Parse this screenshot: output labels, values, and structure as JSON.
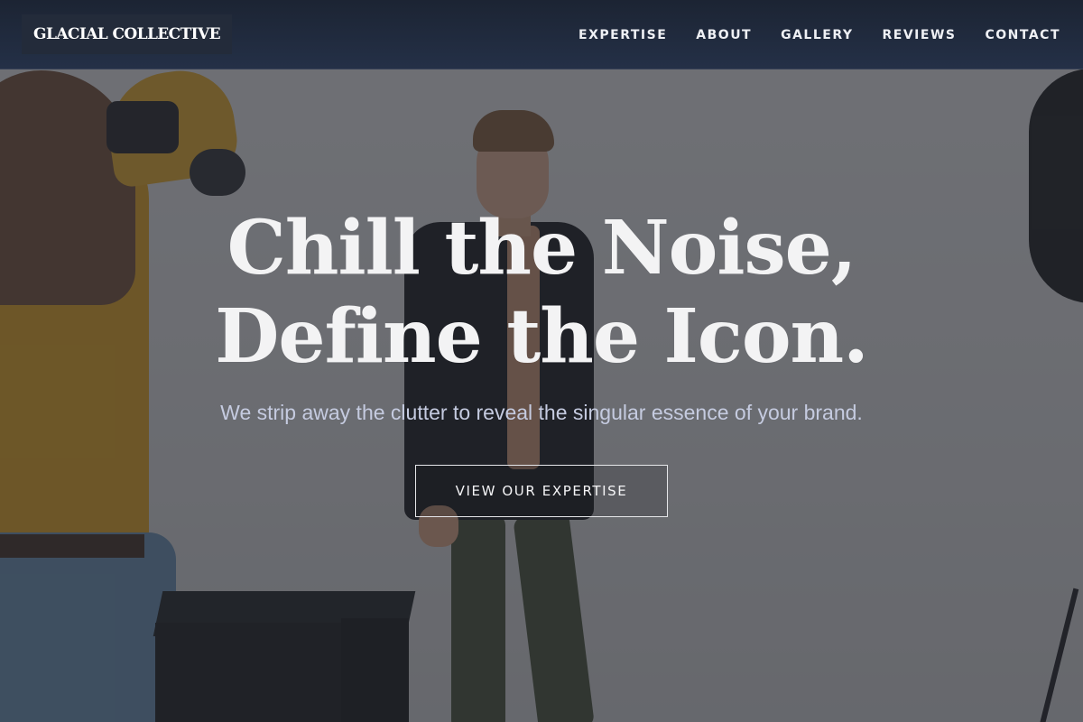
{
  "header": {
    "logo": "GLACIAL COLLECTIVE",
    "nav": [
      {
        "label": "EXPERTISE"
      },
      {
        "label": "ABOUT"
      },
      {
        "label": "GALLERY"
      },
      {
        "label": "REVIEWS"
      },
      {
        "label": "CONTACT"
      }
    ]
  },
  "hero": {
    "headline_line1": "Chill the Noise,",
    "headline_line2": "Define the Icon.",
    "subheadline": "We strip away the clutter to reveal the singular essence of your brand.",
    "cta_label": "VIEW OUR EXPERTISE"
  },
  "colors": {
    "header_bg": "#1c2433",
    "headline": "#f3f3f4",
    "subheadline": "#c5cbe0",
    "overlay": "#282a30"
  }
}
